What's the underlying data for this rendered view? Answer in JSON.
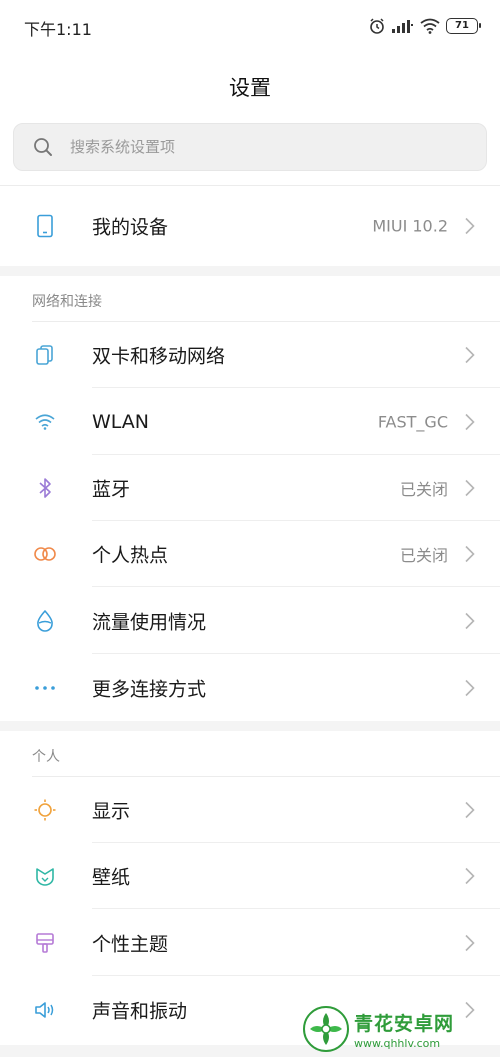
{
  "status_bar": {
    "time": "下午1:11",
    "battery": "71",
    "icons": [
      "alarm-icon",
      "signal-icon",
      "wifi-icon",
      "battery-icon"
    ]
  },
  "header": {
    "title": "设置"
  },
  "search": {
    "placeholder": "搜索系统设置项"
  },
  "device_row": {
    "label": "我的设备",
    "value": "MIUI 10.2",
    "icon": "phone-icon"
  },
  "sections": [
    {
      "header": "网络和连接",
      "items": [
        {
          "label": "双卡和移动网络",
          "value": "",
          "icon": "dual-sim-icon"
        },
        {
          "label": "WLAN",
          "value": "FAST_GC",
          "icon": "wifi-icon"
        },
        {
          "label": "蓝牙",
          "value": "已关闭",
          "icon": "bluetooth-icon"
        },
        {
          "label": "个人热点",
          "value": "已关闭",
          "icon": "hotspot-icon"
        },
        {
          "label": "流量使用情况",
          "value": "",
          "icon": "data-usage-icon"
        },
        {
          "label": "更多连接方式",
          "value": "",
          "icon": "more-dots-icon"
        }
      ]
    },
    {
      "header": "个人",
      "items": [
        {
          "label": "显示",
          "value": "",
          "icon": "display-sun-icon"
        },
        {
          "label": "壁纸",
          "value": "",
          "icon": "wallpaper-icon"
        },
        {
          "label": "个性主题",
          "value": "",
          "icon": "theme-brush-icon"
        },
        {
          "label": "声音和振动",
          "value": "",
          "icon": "speaker-icon"
        }
      ]
    }
  ],
  "watermark": {
    "title": "青花安卓网",
    "url": "www.qhhlv.com"
  },
  "colors": {
    "phone": "#3a9ed9",
    "dual_sim": "#4aa5d6",
    "wifi": "#4aa5d6",
    "bluetooth": "#9b7bd6",
    "hotspot": "#f08a4b",
    "data_usage": "#3a9ed9",
    "more": "#3a9ed9",
    "display": "#f0a23c",
    "wallpaper": "#2fb7a5",
    "theme": "#b57ad6",
    "sound": "#3a9ed9",
    "watermark": "#2f9c3a"
  }
}
